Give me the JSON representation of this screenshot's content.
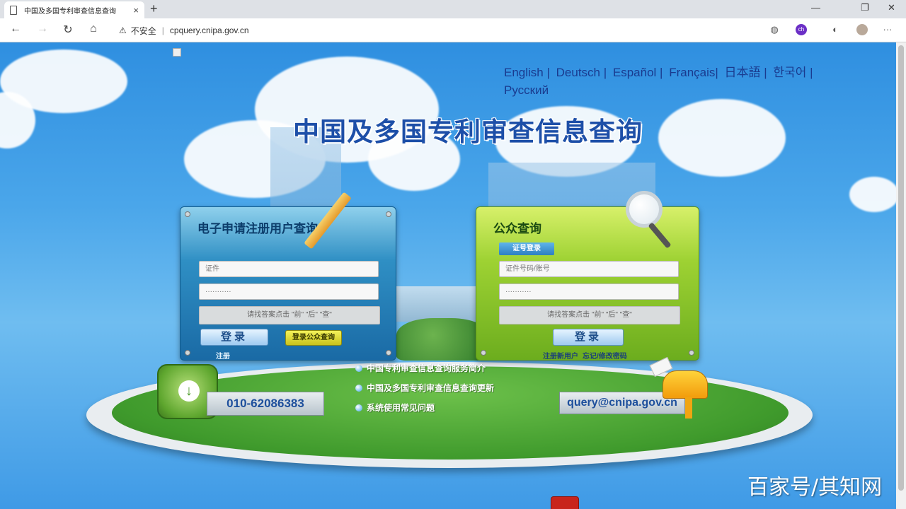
{
  "browser": {
    "tab_title": "中国及多国专利审查信息查询",
    "tab_close": "×",
    "new_tab": "+",
    "window_controls": {
      "minimize": "—",
      "maximize": "❐",
      "close": "✕"
    },
    "nav": {
      "back": "←",
      "forward": "→",
      "reload": "↻",
      "home": "⌂"
    },
    "address": {
      "security_icon": "warning-triangle-icon",
      "security_label": "不安全",
      "separator": "|",
      "url": "cpquery.cnipa.gov.cn"
    },
    "toolbar_icons": [
      "tracking-prevention-icon",
      "extension-icon",
      "collections-icon",
      "profile-avatar",
      "more-menu-icon"
    ],
    "more": "···"
  },
  "page": {
    "languages": [
      "English |",
      "Deutsch |",
      "Español |",
      "Français|",
      "日本語 |",
      "한국어 |",
      "Русский"
    ],
    "headline": "中国及多国专利审查信息查询",
    "registered_panel": {
      "title": "电子申请注册用户查询",
      "username_placeholder": "证件",
      "password_placeholder": "···········",
      "captcha_placeholder": "请找答案点击 \"前\" \"后\" \"查\"",
      "login_button": "登录",
      "public_query_button": "登录公众查询",
      "register_link": "注册"
    },
    "public_panel": {
      "title": "公众查询",
      "tab_label": "证号登录",
      "username_placeholder": "证件号码/账号",
      "password_placeholder": "···········",
      "captcha_placeholder": "请找答案点击 \"前\" \"后\" \"查\"",
      "login_button": "登录",
      "link_left": "注册新用户",
      "link_right": "忘记/修改密码"
    },
    "phone": "010-62086383",
    "email": "query@cnipa.gov.cn",
    "info_links": [
      "中国专利审查信息查询服务简介",
      "中国及多国专利审查信息查询更新",
      "系统使用常见问题"
    ],
    "watermark": "百家号/其知网"
  },
  "colors": {
    "sky": "#4aa6ea",
    "headline": "#1d4fa8",
    "panel_blue": "#1a6aa5",
    "panel_green": "#9ed233",
    "grass": "#4fae33"
  }
}
